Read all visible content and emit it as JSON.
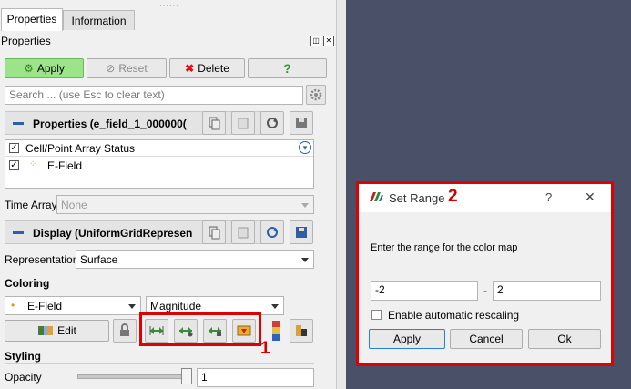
{
  "tabs": [
    {
      "label": "Properties",
      "active": true
    },
    {
      "label": "Information",
      "active": false
    }
  ],
  "panel_title": "Properties",
  "toolbar": {
    "apply": "Apply",
    "reset": "Reset",
    "delete": "Delete",
    "help": "?"
  },
  "search": {
    "placeholder": "Search ... (use Esc to clear text)"
  },
  "properties_section": {
    "title": "Properties (e_field_1_000000("
  },
  "array_status": {
    "header": "Cell/Point Array Status",
    "items": [
      {
        "label": "E-Field",
        "checked": true
      }
    ]
  },
  "time_array": {
    "label": "Time Array",
    "value": "None"
  },
  "display_section": {
    "title": "Display (UniformGridRepresen"
  },
  "representation": {
    "label": "Representation",
    "value": "Surface"
  },
  "coloring": {
    "header": "Coloring",
    "array": "E-Field",
    "component": "Magnitude",
    "edit_label": "Edit"
  },
  "styling": {
    "header": "Styling",
    "opacity_label": "Opacity",
    "opacity_value": "1"
  },
  "annotations": {
    "callout_1": "1",
    "callout_2": "2"
  },
  "dialog": {
    "title": "Set Range",
    "help": "?",
    "close": "✕",
    "prompt": "Enter the range for the color map",
    "min_value": "-2",
    "separator": "-",
    "max_value": "2",
    "auto_rescale_label": "Enable automatic rescaling",
    "apply": "Apply",
    "cancel": "Cancel",
    "ok": "Ok"
  },
  "colors": {
    "accent_red": "#e00000",
    "apply_green": "#9be48a",
    "view_background": "#4a5068"
  }
}
